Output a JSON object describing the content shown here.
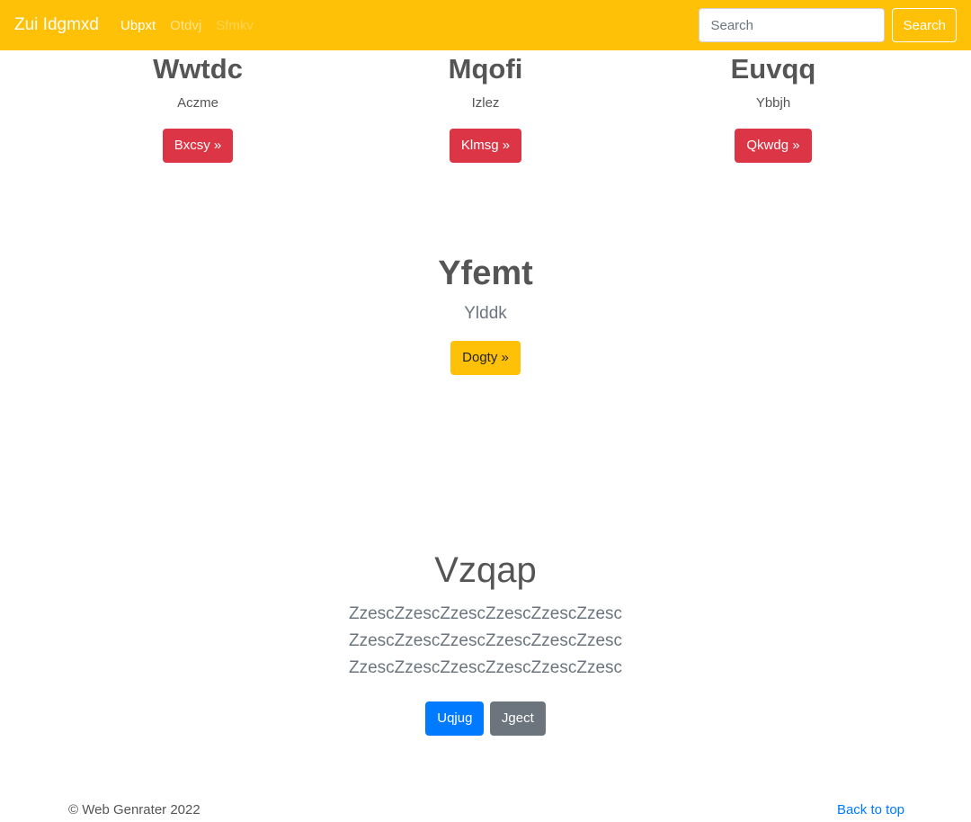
{
  "navbar": {
    "brand": "Zui Idgmxd",
    "links": [
      {
        "label": "Ubpxt"
      },
      {
        "label": "Otdvj"
      },
      {
        "label": "Sfmkv"
      }
    ],
    "search_placeholder": "Search",
    "search_button": "Search"
  },
  "columns": [
    {
      "title": "Wwtdc",
      "text": "Aczme",
      "button": "Bxcsy »"
    },
    {
      "title": "Mqofi",
      "text": "Izlez",
      "button": "Klmsg »"
    },
    {
      "title": "Euvqq",
      "text": "Ybbjh",
      "button": "Qkwdg »"
    }
  ],
  "hero": {
    "title": "Yfemt",
    "subtitle": "Ylddk",
    "button": "Dogty »"
  },
  "jumbotron": {
    "title": "Vzqap",
    "lead": "ZzescZzescZzescZzescZzescZzesc ZzescZzescZzescZzescZzescZzesc ZzescZzescZzescZzescZzescZzesc",
    "primary_button": "Uqjug",
    "secondary_button": "Jgect"
  },
  "footer": {
    "copyright": "© Web Genrater 2022",
    "back_to_top": "Back to top"
  },
  "colors": {
    "navbar": "#ffc107",
    "danger": "#dc3545",
    "primary": "#007bff",
    "secondary": "#6c757d"
  }
}
